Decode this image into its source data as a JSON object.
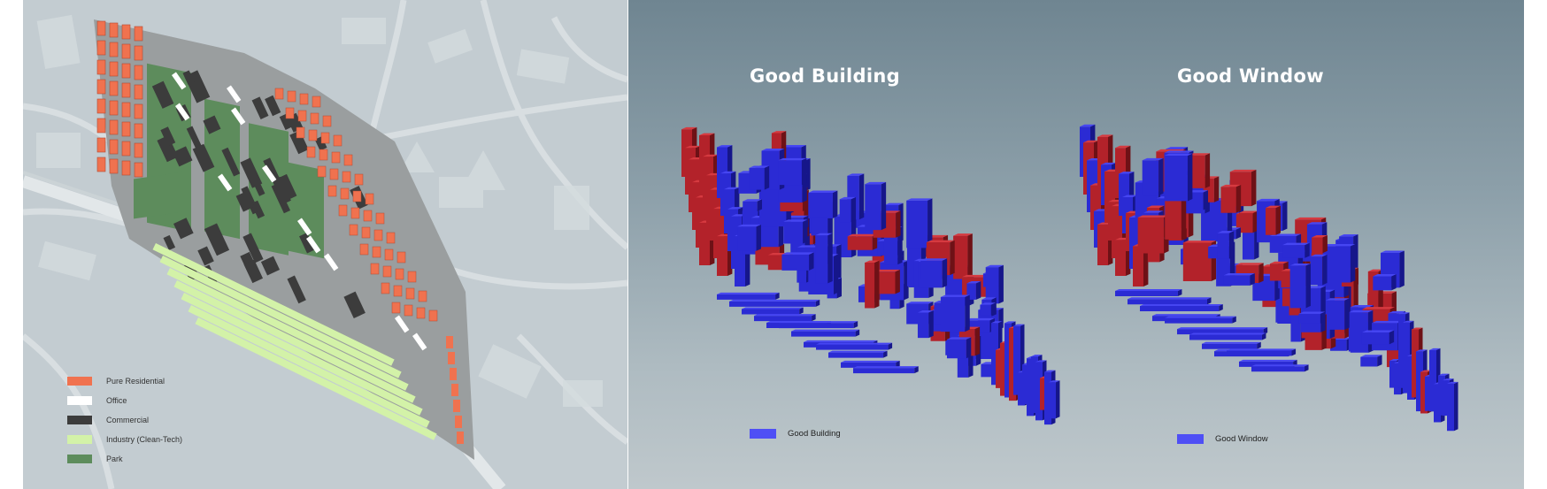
{
  "left_panel": {
    "legend": [
      {
        "label": "Pure Residential",
        "color": "#f0724f"
      },
      {
        "label": "Office",
        "color": "#ffffff"
      },
      {
        "label": "Commercial",
        "color": "#3c3c3c"
      },
      {
        "label": "Industry (Clean-Tech)",
        "color": "#d3f2a8"
      },
      {
        "label": "Park",
        "color": "#5d8c5c"
      }
    ]
  },
  "right_panel": {
    "good_building": {
      "title": "Good Building",
      "legend_label": "Good Building",
      "legend_color": "#4f4ff5"
    },
    "good_window": {
      "title": "Good Window",
      "legend_label": "Good Window",
      "legend_color": "#4f4ff5"
    }
  },
  "colors": {
    "blue": "#2828c8",
    "red": "#c0272d"
  }
}
